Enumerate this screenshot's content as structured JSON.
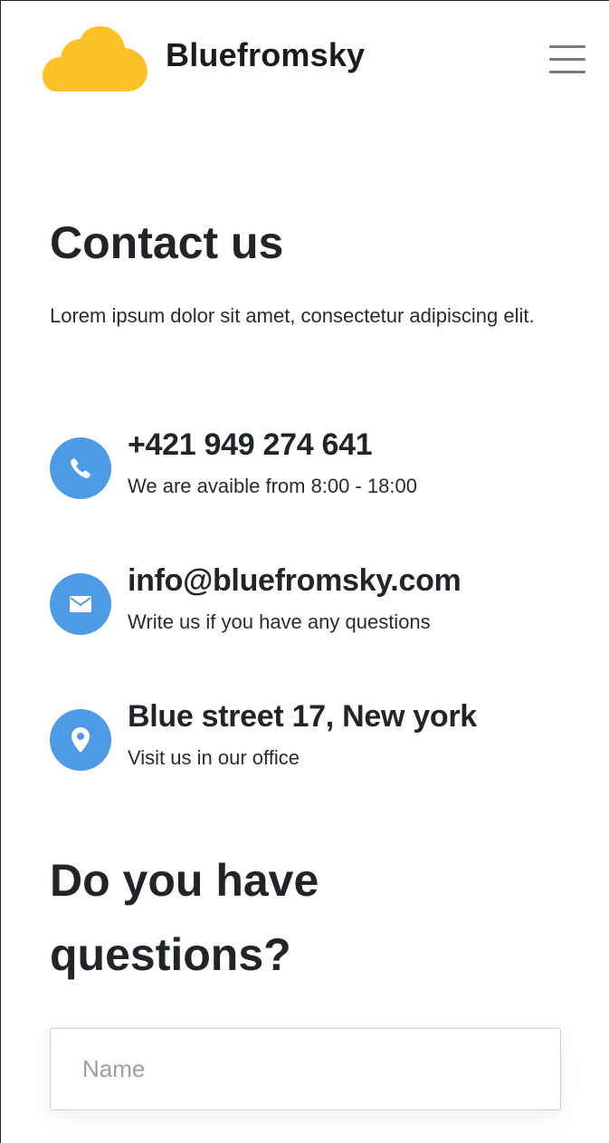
{
  "header": {
    "brand": "Bluefromsky",
    "colors": {
      "logo": "#ffc12a"
    },
    "logo_icon": "cloud-icon",
    "menu_icon": "hamburger-menu-icon"
  },
  "main": {
    "title": "Contact us",
    "intro": "Lorem ipsum dolor sit amet, consectetur adipiscing elit.",
    "contacts": [
      {
        "icon": "phone-icon",
        "title": "+421 949 274 641",
        "subtitle": "We are avaible from 8:00 - 18:00"
      },
      {
        "icon": "envelope-icon",
        "title": "info@bluefromsky.com",
        "subtitle": "Write us if you have any questions"
      },
      {
        "icon": "map-pin-icon",
        "title": "Blue street 17, New york",
        "subtitle": "Visit us in our office"
      }
    ],
    "colors": {
      "icon_background": "#4f9ae5",
      "heading": "#212529"
    }
  },
  "form": {
    "title": "Do you have questions?",
    "name_placeholder": "Name",
    "name_value": ""
  }
}
